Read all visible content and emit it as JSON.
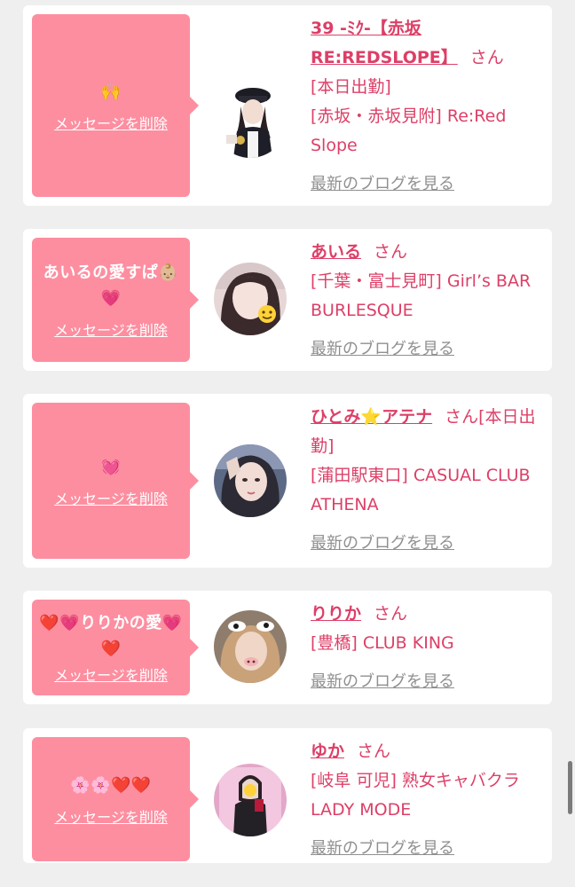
{
  "cards": [
    {
      "message": "🙌",
      "delete_label": "メッセージを削除",
      "name": "39 -ﾐｸ-【赤坂 RE:REDSLOPE】",
      "suffix": "さん",
      "status": "[本日出勤]",
      "shop": "[赤坂・赤坂見附] Re:Red Slope",
      "blog_link": "最新のブログを見る",
      "avatar_icon": "avatar-police-costume"
    },
    {
      "message": "あいるの愛すぱ👶🏼💗",
      "delete_label": "メッセージを削除",
      "name": "あいる",
      "suffix": "さん",
      "status": "",
      "shop": "[千葉・富士見町] Girl’s BAR BURLESQUE",
      "blog_link": "最新のブログを見る",
      "avatar_icon": "avatar-face-sticker"
    },
    {
      "message": "💓",
      "delete_label": "メッセージを削除",
      "name": "ひとみ⭐アテナ",
      "suffix": "さん",
      "status": "[本日出勤]",
      "shop": "[蒲田駅東口] CASUAL CLUB ATHENA",
      "blog_link": "最新のブログを見る",
      "avatar_icon": "avatar-portrait"
    },
    {
      "message": "❤️💗りりかの愛💗❤️",
      "delete_label": "メッセージを削除",
      "name": "りりか",
      "suffix": "さん",
      "status": "",
      "shop": "[豊橋] CLUB KING",
      "blog_link": "最新のブログを見る",
      "avatar_icon": "avatar-cow-filter"
    },
    {
      "message": "🌸🌸❤️❤️",
      "delete_label": "メッセージを削除",
      "name": "ゆか",
      "suffix": "さん",
      "status": "",
      "shop": "[岐阜 可児] 熟女キャバクラ LADY MODE",
      "blog_link": "最新のブログを見る",
      "avatar_icon": "avatar-mirror-selfie"
    }
  ],
  "colors": {
    "bubble": "#fd8ea0",
    "accent": "#dd3f67",
    "link_gray": "#8f8f8f",
    "background": "#efefef"
  }
}
